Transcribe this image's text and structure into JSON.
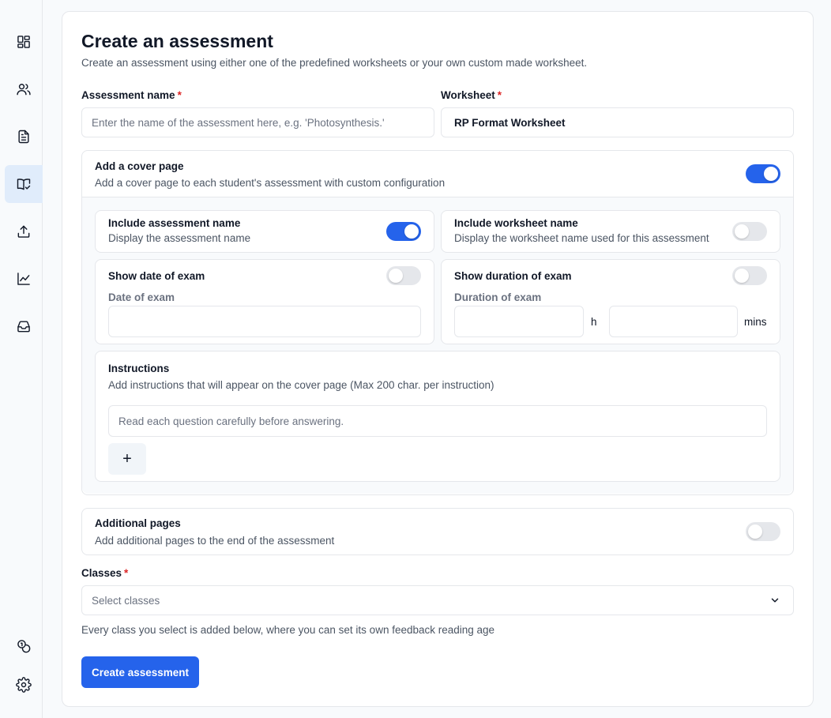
{
  "sidebar": {
    "items": [
      {
        "name": "dashboard-icon"
      },
      {
        "name": "users-icon"
      },
      {
        "name": "document-icon"
      },
      {
        "name": "book-check-icon",
        "active": true
      },
      {
        "name": "upload-icon"
      },
      {
        "name": "chart-line-icon"
      },
      {
        "name": "inbox-icon"
      }
    ],
    "bottom_items": [
      {
        "name": "coins-icon"
      },
      {
        "name": "gear-icon"
      }
    ]
  },
  "page": {
    "title": "Create an assessment",
    "subtitle": "Create an assessment using either one of the predefined worksheets or your own custom made worksheet."
  },
  "form": {
    "assessment_name": {
      "label": "Assessment name",
      "required_mark": "*",
      "value": "",
      "placeholder": "Enter the name of the assessment here, e.g. 'Photosynthesis.'"
    },
    "worksheet": {
      "label": "Worksheet",
      "required_mark": "*",
      "value": "RP Format Worksheet"
    },
    "cover_page": {
      "title": "Add a cover page",
      "description": "Add a cover page to each student's assessment with custom configuration",
      "enabled": true,
      "include_assessment_name": {
        "title": "Include assessment name",
        "description": "Display the assessment name",
        "enabled": true
      },
      "include_worksheet_name": {
        "title": "Include worksheet name",
        "description": "Display the worksheet name used for this assessment",
        "enabled": false
      },
      "show_date": {
        "title": "Show date of exam",
        "enabled": false,
        "field_label": "Date of exam",
        "value": ""
      },
      "show_duration": {
        "title": "Show duration of exam",
        "enabled": false,
        "field_label": "Duration of exam",
        "hours_value": "",
        "hours_unit": "h",
        "mins_value": "",
        "mins_unit": "mins"
      },
      "instructions": {
        "title": "Instructions",
        "description": "Add instructions that will appear on the cover page (Max 200 char. per instruction)",
        "placeholder": "Read each question carefully before answering.",
        "add_label": "+"
      }
    },
    "additional_pages": {
      "title": "Additional pages",
      "description": "Add additional pages to the end of the assessment",
      "enabled": false
    },
    "classes": {
      "label": "Classes",
      "required_mark": "*",
      "placeholder": "Select classes",
      "help": "Every class you select is added below, where you can set its own feedback reading age"
    },
    "submit_label": "Create assessment"
  },
  "colors": {
    "accent": "#2563eb",
    "required": "#dc2626",
    "active_nav": "#e0ecfb"
  }
}
